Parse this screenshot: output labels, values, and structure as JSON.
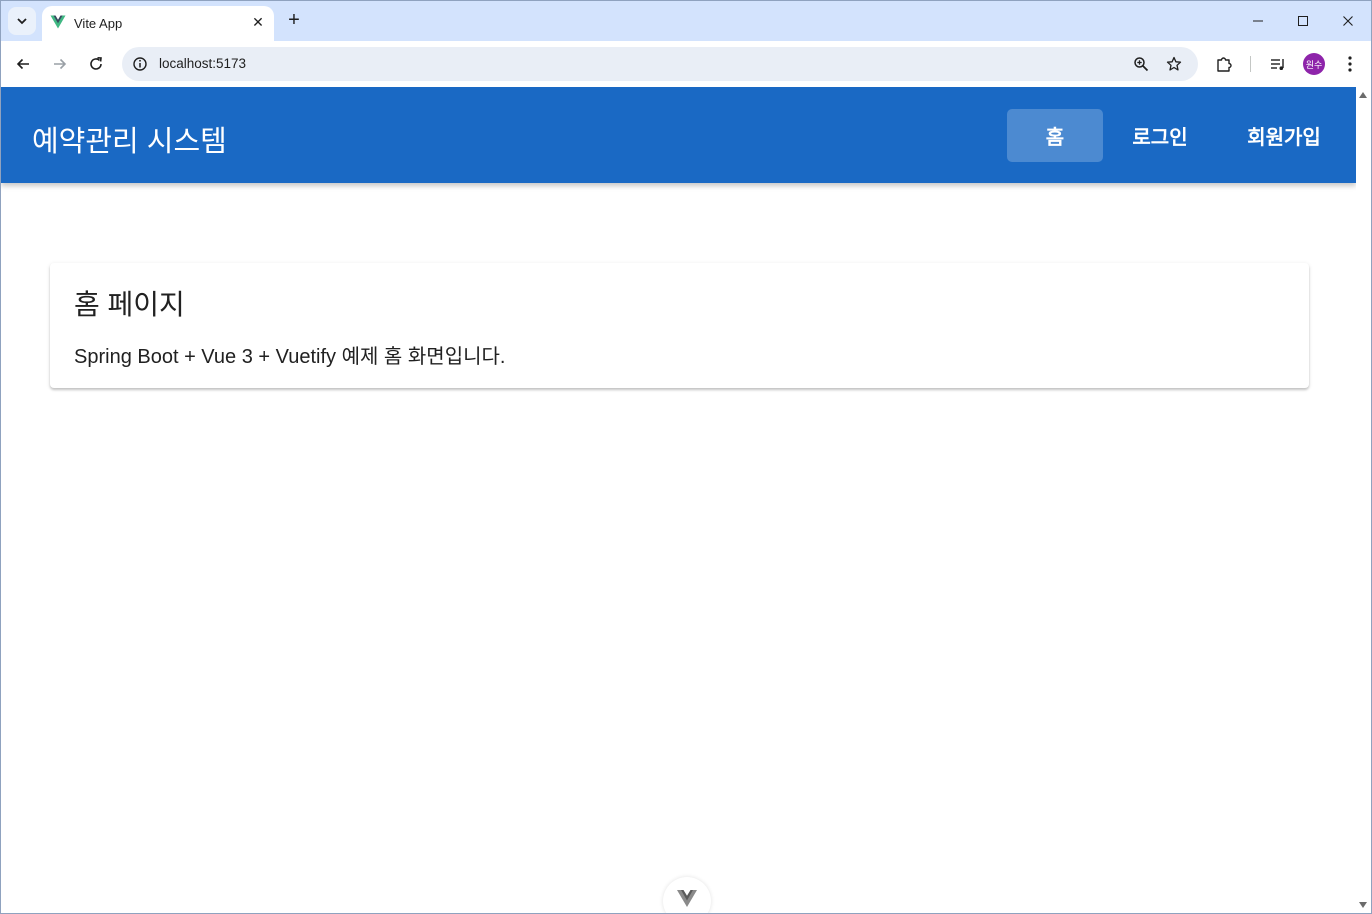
{
  "browser": {
    "tab": {
      "title": "Vite App",
      "close_glyph": "✕"
    },
    "new_tab_glyph": "+",
    "window_controls": {
      "minimize": "─",
      "maximize": "☐",
      "close": "✕"
    },
    "nav": {
      "back": "←",
      "forward": "→",
      "reload": "↻"
    },
    "omnibox": {
      "url": "localhost:5173"
    },
    "profile_initials": "원수"
  },
  "app": {
    "title": "예약관리 시스템",
    "nav_items": [
      {
        "label": "홈",
        "active": true
      },
      {
        "label": "로그인",
        "active": false
      },
      {
        "label": "회원가입",
        "active": false
      }
    ],
    "card": {
      "title": "홈 페이지",
      "text": "Spring Boot + Vue 3 + Vuetify 예제 홈 화면입니다."
    }
  },
  "colors": {
    "app_bar": "#1a69c4",
    "tabstrip": "#d3e3fd",
    "vue_green": "#41b883",
    "vue_dark": "#35495e"
  },
  "icons": {
    "tab_search": "chevron-down-icon",
    "site_info": "info-icon",
    "zoom": "zoom-icon",
    "bookmark": "star-icon",
    "extensions": "puzzle-icon",
    "media": "queue-music-icon",
    "menu": "more-vertical-icon",
    "devtools": "vue-devtools-icon"
  }
}
